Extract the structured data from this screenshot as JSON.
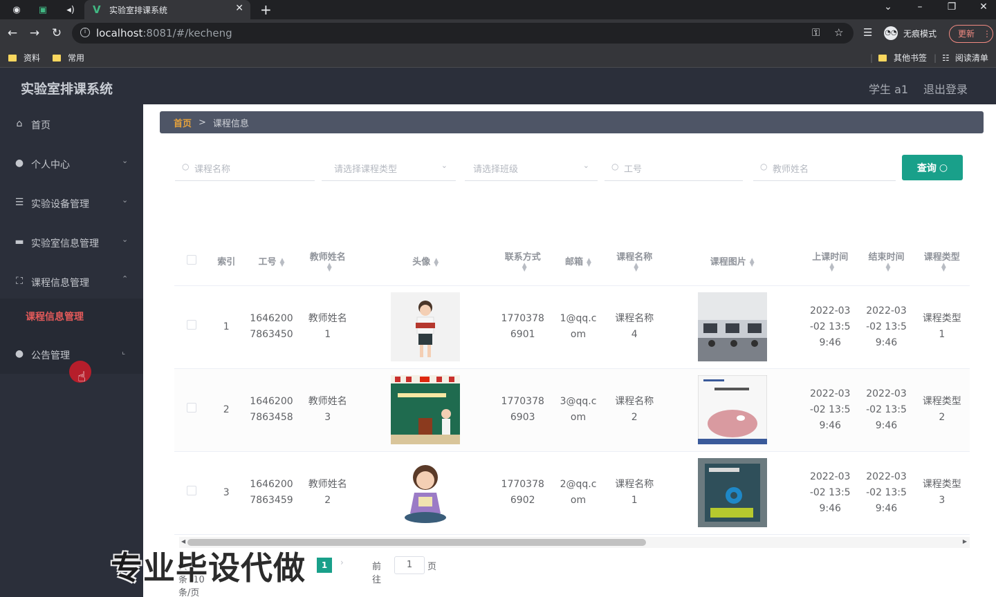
{
  "browser": {
    "tab_title": "实验室排课系统",
    "url_host": "localhost",
    "url_rest": ":8081/#/kecheng",
    "incognito_label": "无痕模式",
    "update_label": "更新",
    "bookmarks": [
      "资料",
      "常用"
    ],
    "bookmarks_right": [
      "其他书签",
      "阅读清单"
    ]
  },
  "app": {
    "title": "实验室排课系统",
    "user": "学生 a1",
    "logout": "退出登录"
  },
  "sidebar": {
    "items": [
      {
        "label": "首页",
        "icon": "home-icon"
      },
      {
        "label": "个人中心",
        "icon": "user-icon"
      },
      {
        "label": "实验设备管理",
        "icon": "sliders-icon"
      },
      {
        "label": "实验室信息管理",
        "icon": "monitor-icon"
      },
      {
        "label": "课程信息管理",
        "icon": "frame-icon"
      },
      {
        "label": "公告管理",
        "icon": "user-icon"
      }
    ],
    "sub_active": "课程信息管理"
  },
  "breadcrumb": {
    "home": "首页",
    "sep": ">",
    "current": "课程信息"
  },
  "filters": {
    "course_name": "课程名称",
    "course_type": "请选择课程类型",
    "class": "请选择班级",
    "staff_no": "工号",
    "teacher_name": "教师姓名",
    "search_button": "查询"
  },
  "table": {
    "headers": [
      "索引",
      "工号",
      "教师姓名",
      "头像",
      "联系方式",
      "邮箱",
      "课程名称",
      "课程图片",
      "上课时间",
      "结束时间",
      "课程类型"
    ],
    "rows": [
      {
        "index": "1",
        "staff_no": [
          "1646200",
          "7863450"
        ],
        "teacher": [
          "教师姓名",
          "1"
        ],
        "phone": [
          "1770378",
          "6901"
        ],
        "email": [
          "1@qq.c",
          "om"
        ],
        "course": [
          "课程名称",
          "4"
        ],
        "start": [
          "2022-03",
          "-02 13:5",
          "9:46"
        ],
        "end": [
          "2022-03",
          "-02 13:5",
          "9:46"
        ],
        "type": [
          "课程类型",
          "1"
        ]
      },
      {
        "index": "2",
        "staff_no": [
          "1646200",
          "7863458"
        ],
        "teacher": [
          "教师姓名",
          "3"
        ],
        "phone": [
          "1770378",
          "6903"
        ],
        "email": [
          "3@qq.c",
          "om"
        ],
        "course": [
          "课程名称",
          "2"
        ],
        "start": [
          "2022-03",
          "-02 13:5",
          "9:46"
        ],
        "end": [
          "2022-03",
          "-02 13:5",
          "9:46"
        ],
        "type": [
          "课程类型",
          "2"
        ]
      },
      {
        "index": "3",
        "staff_no": [
          "1646200",
          "7863459"
        ],
        "teacher": [
          "教师姓名",
          "2"
        ],
        "phone": [
          "1770378",
          "6902"
        ],
        "email": [
          "2@qq.c",
          "om"
        ],
        "course": [
          "课程名称",
          "1"
        ],
        "start": [
          "2022-03",
          "-02 13:5",
          "9:46"
        ],
        "end": [
          "2022-03",
          "-02 13:5",
          "9:46"
        ],
        "type": [
          "课程类型",
          "3"
        ]
      }
    ]
  },
  "pagination": {
    "total": "共 3 条",
    "page_size": "10条/页",
    "current": "1",
    "goto": "前往",
    "input": "1",
    "page": "页"
  },
  "overlay_text": "专业毕设代做",
  "colors": {
    "accent": "#19a08a",
    "sidebar_bg": "#2b2f3a",
    "active_sub": "#e45a5a",
    "breadcrumb_home": "#e6a23c"
  }
}
